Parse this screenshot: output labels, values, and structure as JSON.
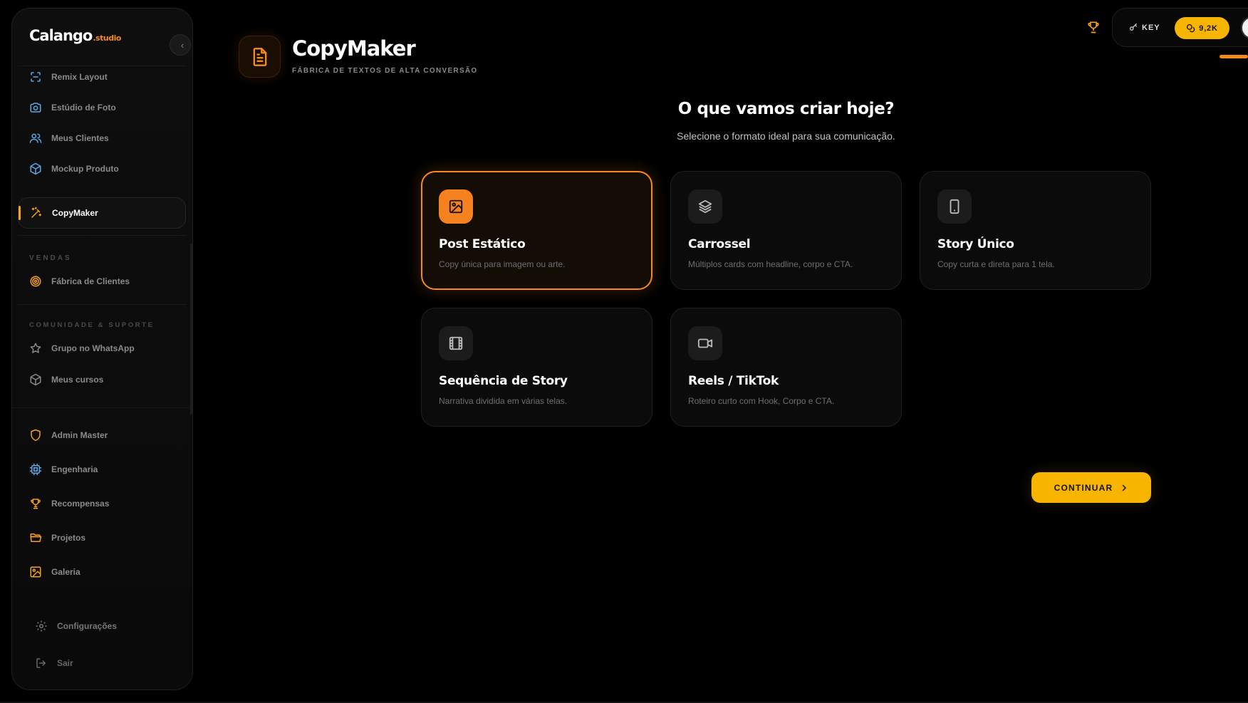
{
  "brand": {
    "name": "Calango",
    "suffix": ".studio",
    "accent": "#f58a1f"
  },
  "sidebar": {
    "items_top": [
      {
        "label": "Remix Layout",
        "icon": "scan-icon"
      },
      {
        "label": "Estúdio de Foto",
        "icon": "camera-icon"
      },
      {
        "label": "Meus Clientes",
        "icon": "users-icon"
      },
      {
        "label": "Mockup Produto",
        "icon": "box-icon"
      },
      {
        "label": "CopyMaker",
        "icon": "magic-wand-icon",
        "active": true
      }
    ],
    "section_sales": "VENDAS",
    "sales_items": [
      {
        "label": "Fábrica de Clientes",
        "icon": "target-icon"
      }
    ],
    "section_community": "COMUNIDADE & SUPORTE",
    "community_items": [
      {
        "label": "Grupo no WhatsApp",
        "icon": "star-icon"
      },
      {
        "label": "Meus cursos",
        "icon": "package-icon"
      }
    ],
    "admin_items": [
      {
        "label": "Admin Master",
        "icon": "shield-icon"
      },
      {
        "label": "Engenharia",
        "icon": "cpu-icon"
      },
      {
        "label": "Recompensas",
        "icon": "trophy-icon"
      },
      {
        "label": "Projetos",
        "icon": "folder-icon"
      },
      {
        "label": "Galeria",
        "icon": "gallery-icon"
      }
    ],
    "settings": "Configurações",
    "logout": "Sair"
  },
  "header": {
    "title": "CopyMaker",
    "subtitle": "FÁBRICA DE TEXTOS DE ALTA CONVERSÃO"
  },
  "topbar": {
    "key_label": "KEY",
    "credits": "9,2K"
  },
  "main": {
    "question": "O que vamos criar hoje?",
    "question_sub": "Selecione o formato ideal para sua comunicação.",
    "formats": [
      {
        "title": "Post Estático",
        "desc": "Copy única para imagem ou arte.",
        "icon": "image-icon",
        "selected": true
      },
      {
        "title": "Carrossel",
        "desc": "Múltiplos cards com headline, corpo e CTA.",
        "icon": "layers-icon"
      },
      {
        "title": "Story Único",
        "desc": "Copy curta e direta para 1 tela.",
        "icon": "phone-icon"
      },
      {
        "title": "Sequência de Story",
        "desc": "Narrativa dividida em várias telas.",
        "icon": "film-icon"
      },
      {
        "title": "Reels / TikTok",
        "desc": "Roteiro curto com Hook, Corpo e CTA.",
        "icon": "video-icon"
      }
    ],
    "continue_label": "CONTINUAR"
  },
  "colors": {
    "accent": "#f58a1f",
    "yellow": "#f7b500",
    "blue_icon": "#5aa9e6"
  }
}
